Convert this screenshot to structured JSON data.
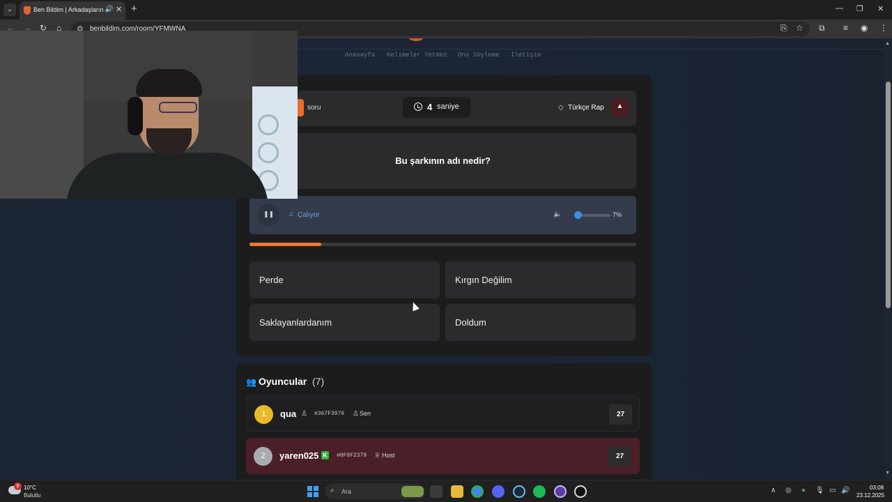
{
  "browser": {
    "tab_title": "Ben Bildim | Arkadaşlarınla",
    "url": "benbildim.com/room/YFMWNA",
    "new_tab_symbol": "+",
    "tab_close_symbol": "✕"
  },
  "site": {
    "nav": [
      "Anasayfa",
      "Kelimeler Yetmez",
      "Onu Söyleme",
      "İletişim"
    ]
  },
  "game": {
    "question_label": "soru",
    "timer_value": "4",
    "timer_unit": "saniye",
    "category": "Türkçe Rap",
    "question": "Bu şarkının adı nedir?",
    "player_status": "Çalıyor",
    "volume_percent": 7,
    "volume_label": "7%",
    "song_progress": 0.185,
    "answers": [
      "Perde",
      "Kırgın Değilim",
      "Saklayanlardanım",
      "Doldum"
    ]
  },
  "players": {
    "title": "Oyuncular",
    "count": "(7)",
    "list": [
      {
        "rank": "1",
        "name": "qua",
        "code": "#367F3976",
        "badge": "Sen",
        "score": "27"
      },
      {
        "rank": "2",
        "name": "yaren025",
        "code": "#0F8F2379",
        "badge": "Host",
        "score": "27"
      }
    ]
  },
  "taskbar": {
    "weather_badge": "9",
    "temperature": "10°C",
    "weather": "Bulutlu",
    "search_placeholder": "Ara",
    "time": "03:08",
    "date": "23.12.2025"
  },
  "colors": {
    "accent": "#ee7a2e",
    "playing": "#6aa6e8",
    "host_row": "#4a1f28",
    "self_row": "#1f1f21"
  },
  "icons": [
    "clock-icon",
    "tag-icon",
    "warning-icon",
    "pause-icon",
    "music-note-icon",
    "volume-icon",
    "users-icon",
    "user-icon",
    "crown-icon"
  ]
}
